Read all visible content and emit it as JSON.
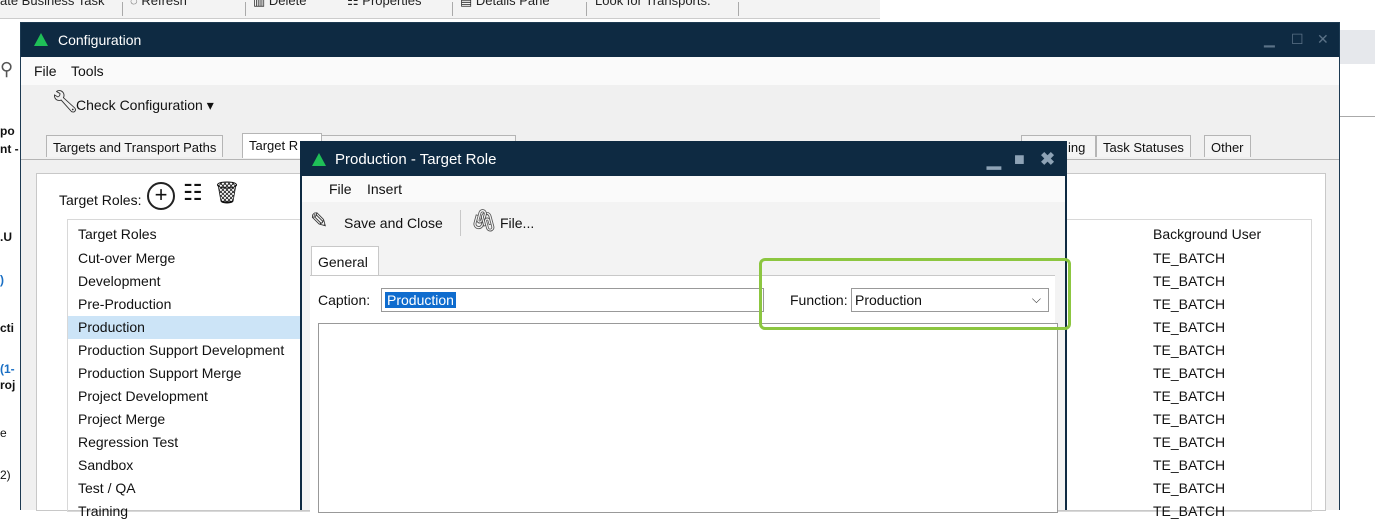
{
  "bg": {
    "toolbar": {
      "create_task": "ate Business Task",
      "refresh": "Refresh",
      "delete": "Delete",
      "properties": "Properties",
      "details_pane": "Details Pane",
      "look_for_transports": "Look for Transports."
    },
    "left_fragments": [
      "po",
      "nt -",
      ".U",
      ")",
      "cti",
      "(1-",
      "roj",
      "e",
      "2)"
    ]
  },
  "config": {
    "title": "Configuration",
    "menu": {
      "file": "File",
      "tools": "Tools"
    },
    "toolbar": {
      "check": "Check Configuration"
    },
    "tabs": [
      "Targets and Transport Paths",
      "Target R",
      "ing",
      "Task Statuses",
      "Other"
    ],
    "target_roles_label": "Target Roles:",
    "grid": {
      "col_target_roles": "Target Roles",
      "col_background_user": "Background User",
      "roles": [
        "Cut-over Merge",
        "Development",
        "Pre-Production",
        "Production",
        "Production Support Development",
        "Production Support Merge",
        "Project Development",
        "Project Merge",
        "Regression Test",
        "Sandbox",
        "Test / QA",
        "Training"
      ],
      "background_users": [
        "TE_BATCH",
        "TE_BATCH",
        "TE_BATCH",
        "TE_BATCH",
        "TE_BATCH",
        "TE_BATCH",
        "TE_BATCH",
        "TE_BATCH",
        "TE_BATCH",
        "TE_BATCH",
        "TE_BATCH",
        "TE_BATCH"
      ],
      "selected": "Production"
    }
  },
  "dialog": {
    "title": "Production - Target Role",
    "menu": {
      "file": "File",
      "insert": "Insert"
    },
    "toolbar": {
      "save_close": "Save and Close",
      "file": "File..."
    },
    "tab_general": "General",
    "caption_label": "Caption:",
    "caption_value": "Production",
    "function_label": "Function:",
    "function_value": "Production"
  },
  "colors": {
    "titlebar": "#0e2a42",
    "accent_green": "#1fbf57",
    "highlight": "#8cc640",
    "selection": "#cce4f7"
  }
}
